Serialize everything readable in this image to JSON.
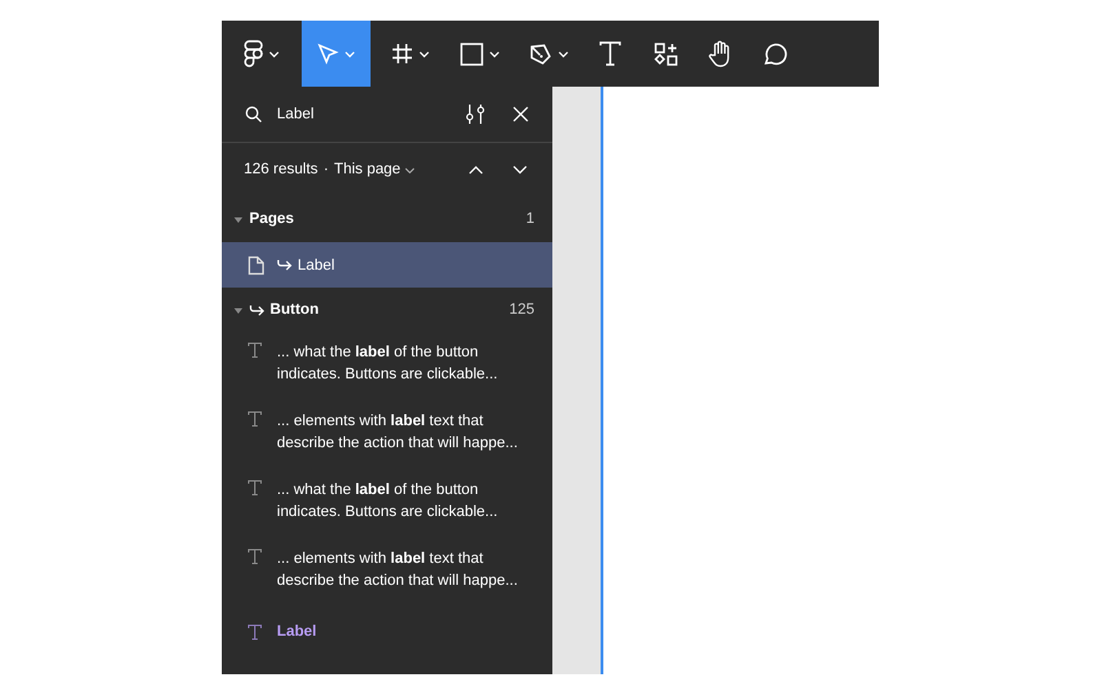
{
  "toolbar": {
    "tools": [
      {
        "kind": "logo",
        "selected": false,
        "caret": true
      },
      {
        "kind": "move",
        "selected": true,
        "caret": true
      },
      {
        "kind": "frame",
        "selected": false,
        "caret": true
      },
      {
        "kind": "shape",
        "selected": false,
        "caret": true
      },
      {
        "kind": "pen",
        "selected": false,
        "caret": true
      },
      {
        "kind": "text",
        "selected": false,
        "caret": false
      },
      {
        "kind": "resources",
        "selected": false,
        "caret": false
      },
      {
        "kind": "hand",
        "selected": false,
        "caret": false
      },
      {
        "kind": "comment",
        "selected": false,
        "caret": false
      }
    ]
  },
  "search": {
    "value": "Label"
  },
  "results_bar": {
    "count": "126 results",
    "separator": "·",
    "scope": "This page"
  },
  "groups": [
    {
      "title": "Pages",
      "link": false,
      "count": "1",
      "expanded": true,
      "items": [
        {
          "kind": "page",
          "text": "Label",
          "selected": true
        }
      ]
    },
    {
      "title": "Button",
      "link": true,
      "count": "125",
      "expanded": true,
      "items": [
        {
          "kind": "text",
          "text": "... what the **label** of the button\nindicates. Buttons are clickable...",
          "selected": false
        },
        {
          "kind": "text",
          "text": "... elements with **label** text that\ndescribe the action that will happe...",
          "selected": false
        },
        {
          "kind": "text",
          "text": "... what the **label** of the button\nindicates. Buttons are clickable...",
          "selected": false
        },
        {
          "kind": "text",
          "text": "... elements with **label** text that\ndescribe the action that will happe...",
          "selected": false
        },
        {
          "kind": "layer",
          "text": "**Label**",
          "selected": false
        }
      ]
    }
  ]
}
